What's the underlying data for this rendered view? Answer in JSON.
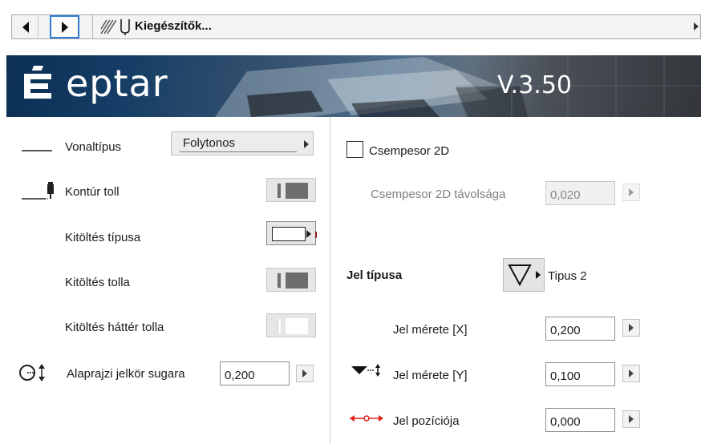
{
  "nav": {
    "breadcrumb_title": "Kiegészítők..."
  },
  "banner": {
    "brand": "eptar",
    "version": "V.3.50"
  },
  "left": {
    "line_type_label": "Vonaltípus",
    "line_type_value": "Folytonos",
    "contour_pen_label": "Kontúr toll",
    "fill_type_label": "Kitöltés típusa",
    "fill_pen_label": "Kitöltés tolla",
    "fill_bg_pen_label": "Kitöltés háttér tolla",
    "radius_label": "Alaprajzi jelkör sugara",
    "radius_value": "0,200"
  },
  "right": {
    "tile_2d_label": "Csempesor 2D",
    "tile_2d_checked": false,
    "tile_2d_distance_label": "Csempesor 2D távolsága",
    "tile_2d_distance_value": "0,020",
    "marker_type_label": "Jel típusa",
    "marker_type_value": "Tipus 2",
    "marker_size_x_label": "Jel mérete [X]",
    "marker_size_x_value": "0,200",
    "marker_size_y_label": "Jel mérete [Y]",
    "marker_size_y_value": "0,100",
    "marker_position_label": "Jel pozíciója",
    "marker_position_value": "0,000"
  },
  "colors": {
    "focus_border": "#2f7bd6",
    "banner_dark": "#0b2f55",
    "pen_gray": "#6d6d6d",
    "position_icon_red": "#e02020"
  }
}
